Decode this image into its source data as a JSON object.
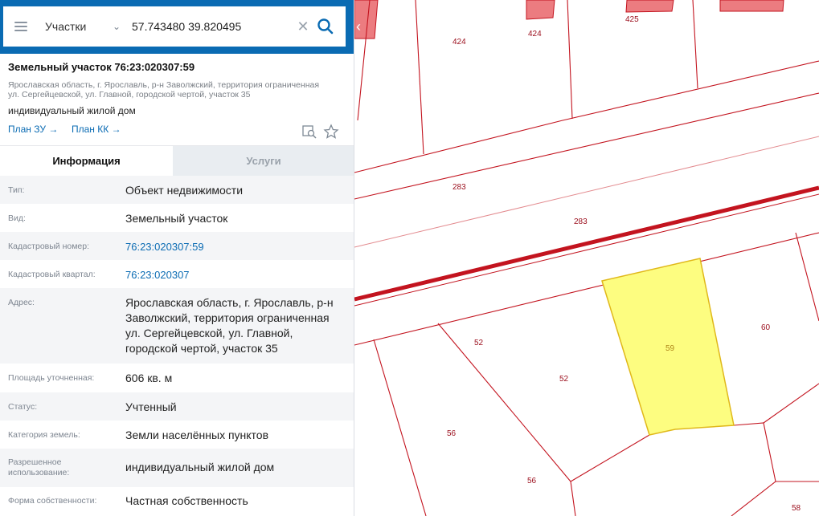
{
  "search": {
    "layer_select": "Участки",
    "query": "57.743480 39.820495"
  },
  "card": {
    "title": "Земельный участок 76:23:020307:59",
    "address_line1": "Ярославская область, г. Ярославль, р-н Заволжский, территория ограниченная",
    "address_line2": "ул. Сергейцевской, ул. Главной, городской чертой, участок 35",
    "use": "индивидуальный жилой дом",
    "plan_zu": "План ЗУ →",
    "plan_kk": "План КК →"
  },
  "tabs": {
    "info": "Информация",
    "services": "Услуги"
  },
  "rows": [
    {
      "label": "Тип:",
      "value": "Объект недвижимости"
    },
    {
      "label": "Вид:",
      "value": "Земельный участок"
    },
    {
      "label": "Кадастровый номер:",
      "value": "76:23:020307:59"
    },
    {
      "label": "Кадастровый квартал:",
      "value": "76:23:020307"
    },
    {
      "label": "Адрес:",
      "value_lines": [
        "Ярославская область, г. Ярославль, р-н",
        "Заволжский, территория ограниченная",
        "ул. Сергейцевской, ул. Главной,",
        "городской чертой, участок 35"
      ]
    },
    {
      "label": "Площадь уточненная:",
      "value": "606 кв. м"
    },
    {
      "label": "Статус:",
      "value": "Учтенный"
    },
    {
      "label": "Категория земель:",
      "value": "Земли населённых пунктов"
    },
    {
      "label_lines": [
        "Разрешенное",
        "использование:"
      ],
      "value": "индивидуальный жилой дом"
    },
    {
      "label": "Форма собственности:",
      "value": "Частная собственность"
    }
  ],
  "map": {
    "parcel_labels": [
      "424",
      "424",
      "425",
      "283",
      "283",
      "52",
      "52",
      "59",
      "60",
      "56",
      "56",
      "58"
    ],
    "colors": {
      "boundary": "#c3141f",
      "selected_fill": "#fdfd80",
      "selected_stroke": "#e0b81a",
      "building": "#ec7c80",
      "accent": "#0a6bb3"
    }
  }
}
